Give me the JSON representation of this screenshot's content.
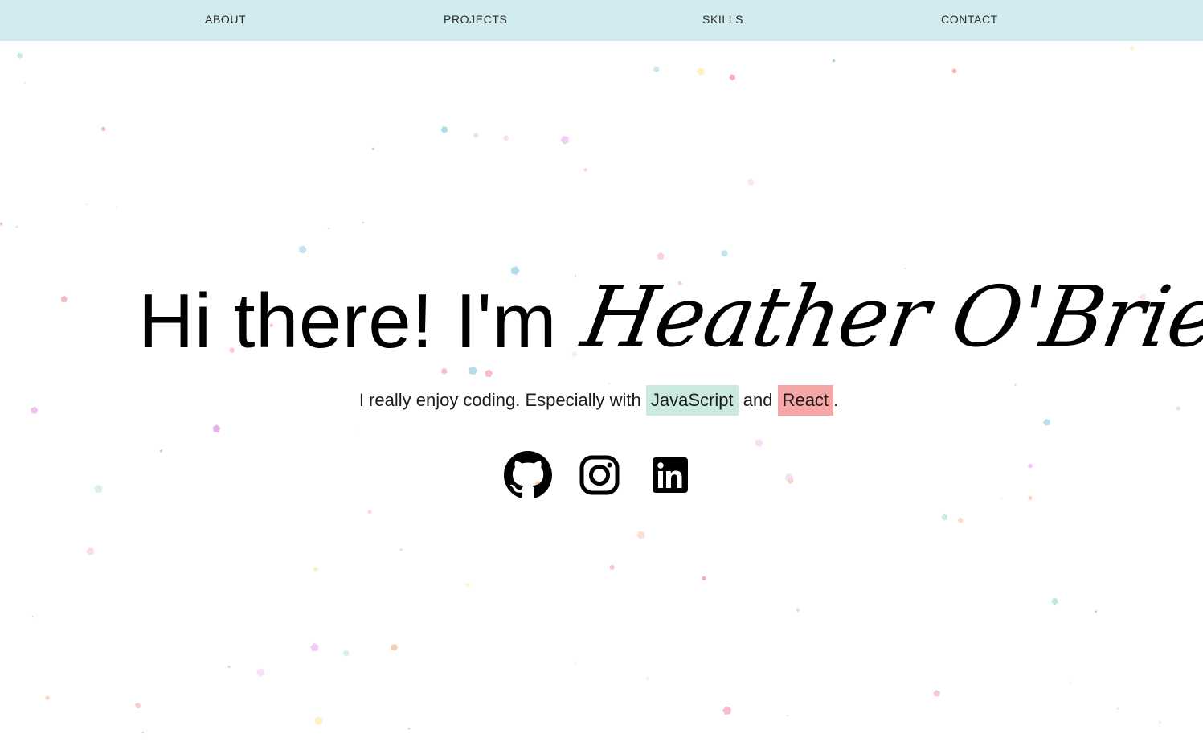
{
  "nav": {
    "items": [
      {
        "label": "ABOUT"
      },
      {
        "label": "PROJECTS"
      },
      {
        "label": "SKILLS"
      },
      {
        "label": "CONTACT"
      }
    ],
    "background": "#d2ebef"
  },
  "hero": {
    "greeting": "Hi there! I'm",
    "name": "Heather O'Brien",
    "tagline": {
      "prefix": "I really enjoy coding. Especially with",
      "highlight_one": "JavaScript",
      "middle": "and",
      "highlight_two": "React",
      "suffix": "."
    },
    "highlight_colors": {
      "javascript": "#c9eadc",
      "react": "#f6a6a6"
    }
  },
  "socials": [
    {
      "icon": "github-icon"
    },
    {
      "icon": "instagram-icon"
    },
    {
      "icon": "linkedin-icon"
    }
  ],
  "confetti_colors": [
    "#f28b8b",
    "#f7b6c8",
    "#f5d3f0",
    "#fbeaa0",
    "#bfe6dc",
    "#9fd3e6",
    "#f6c2a8",
    "#e6a6e8"
  ]
}
